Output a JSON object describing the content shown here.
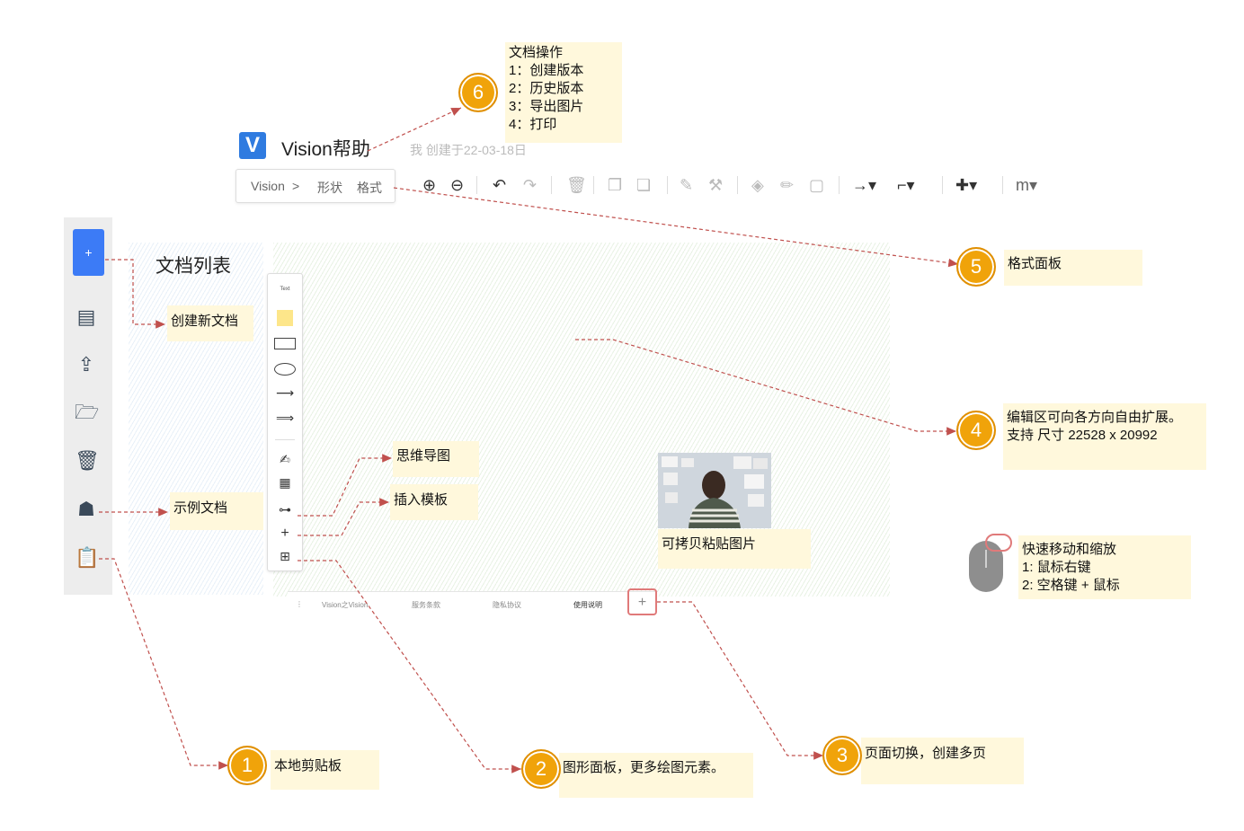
{
  "app": {
    "logo_letter": "V",
    "title": "Vision帮助",
    "created": "我 创建于22-03-18日"
  },
  "toolbar": {
    "breadcrumb_root": "Vision",
    "breadcrumb_sep": ">",
    "tab_shape": "形状",
    "tab_format": "格式"
  },
  "sidebar": {
    "new_label": "+",
    "doc_list_title": "文档列表"
  },
  "shape_panel": {
    "text_label": "Text",
    "add_label": "+"
  },
  "page_tabs": {
    "menu": "⋮",
    "tabs": [
      "Vision之Vision",
      "服务条款",
      "隐私协议",
      "使用说明"
    ],
    "add_label": "+"
  },
  "annotations": {
    "n1": {
      "num": "1",
      "text": "本地剪贴板"
    },
    "n2": {
      "num": "2",
      "text": "图形面板，更多绘图元素。"
    },
    "n3": {
      "num": "3",
      "text": "页面切换，创建多页"
    },
    "n4": {
      "num": "4",
      "line1": "编辑区可向各方向自由扩展。",
      "line2": "支持 尺寸 22528 x 20992"
    },
    "n5": {
      "num": "5",
      "text": "格式面板"
    },
    "n6": {
      "num": "6",
      "lines": [
        "文档操作",
        "1：创建版本",
        "2：历史版本",
        "3：导出图片",
        "4：打印"
      ]
    },
    "new_doc": "创建新文档",
    "example_doc": "示例文档",
    "mindmap": "思维导图",
    "insert_template": "插入模板",
    "paste_image": "可拷贝粘贴图片",
    "mouse": {
      "title": "快速移动和缩放",
      "line1": "1:    鼠标右键",
      "line2": "2:    空格键 + 鼠标"
    }
  },
  "colors": {
    "accent": "#3c7bf6",
    "badge": "#f0a30a",
    "note_bg": "#fff8dc",
    "arrow": "#c0504d"
  }
}
